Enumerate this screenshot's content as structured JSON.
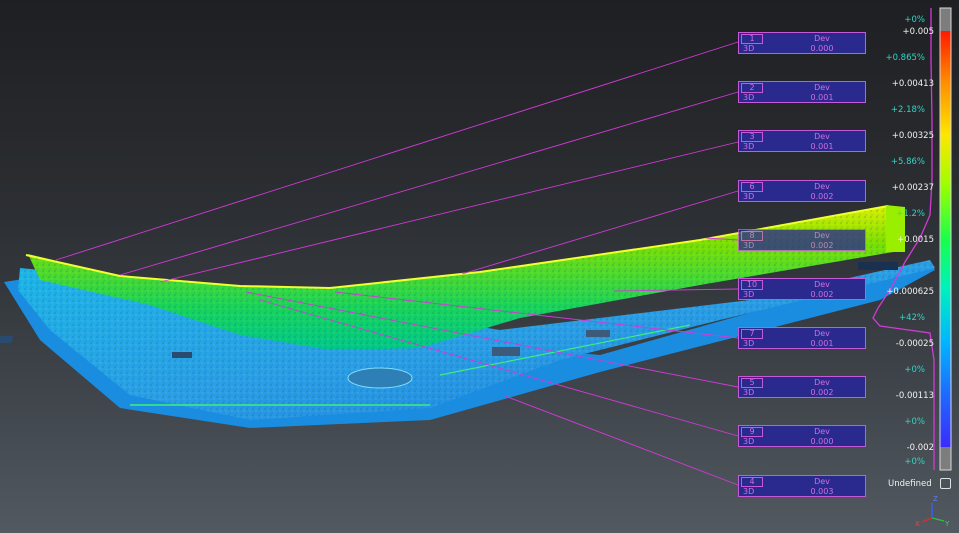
{
  "labels": [
    {
      "index": "1",
      "kind": "3D",
      "metric": "Dev",
      "value": "0.000"
    },
    {
      "index": "2",
      "kind": "3D",
      "metric": "Dev",
      "value": "0.001"
    },
    {
      "index": "3",
      "kind": "3D",
      "metric": "Dev",
      "value": "0.001"
    },
    {
      "index": "6",
      "kind": "3D",
      "metric": "Dev",
      "value": "0.002"
    },
    {
      "index": "8",
      "kind": "3D",
      "metric": "Dev",
      "value": "0.002"
    },
    {
      "index": "10",
      "kind": "3D",
      "metric": "Dev",
      "value": "0.002"
    },
    {
      "index": "7",
      "kind": "3D",
      "metric": "Dev",
      "value": "0.001"
    },
    {
      "index": "5",
      "kind": "3D",
      "metric": "Dev",
      "value": "0.002"
    },
    {
      "index": "9",
      "kind": "3D",
      "metric": "Dev",
      "value": "0.000"
    },
    {
      "index": "4",
      "kind": "3D",
      "metric": "Dev",
      "value": "0.003"
    }
  ],
  "scalar_bar": {
    "values": [
      "+0.005",
      "+0.00413",
      "+0.00325",
      "+0.00237",
      "+0.0015",
      "+0.000625",
      "-0.00025",
      "-0.00113",
      "-0.002"
    ],
    "percents": [
      "+0%",
      "+0.865%",
      "+2.18%",
      "+5.86%",
      "+1.2%",
      "+42%",
      "+0%",
      "+0%",
      "+0%"
    ],
    "undefined_label": "Undefined",
    "colors": [
      "#ff1a00",
      "#ff8a00",
      "#ffe600",
      "#9dff00",
      "#19ff4a",
      "#00f0c0",
      "#00b4ff",
      "#2066ff",
      "#3a2cff"
    ]
  },
  "axis_gizmo": {
    "z": "Z",
    "x": "X",
    "y": "Y"
  }
}
